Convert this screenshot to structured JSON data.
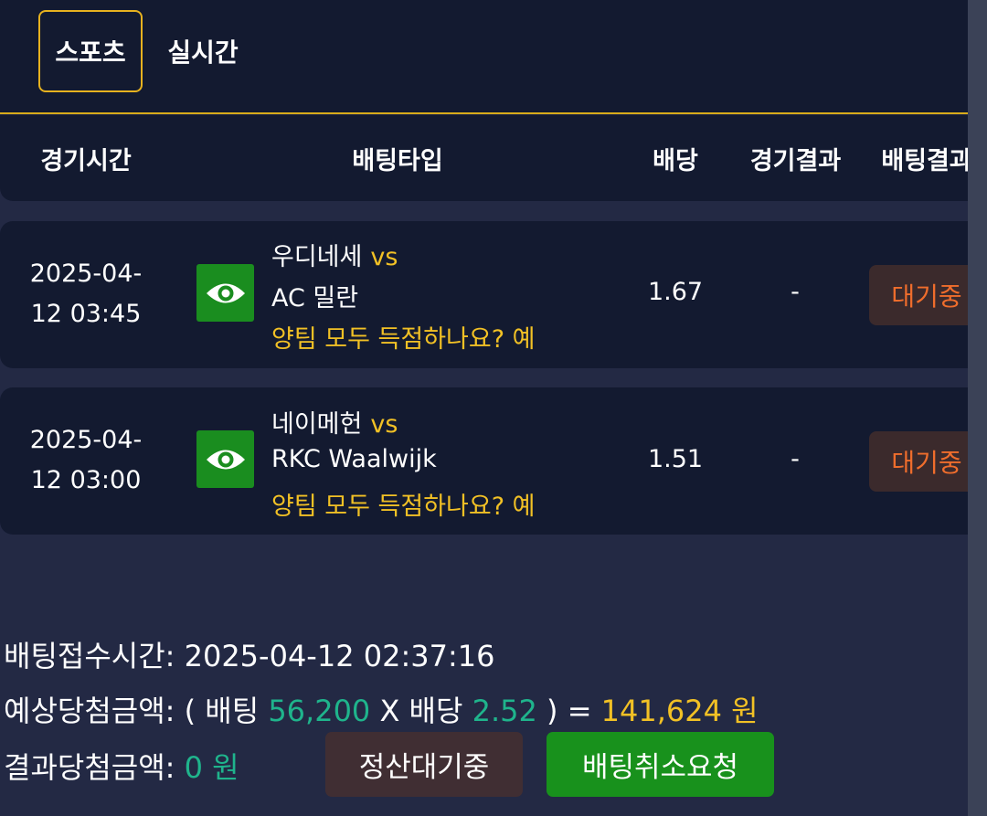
{
  "tabs": [
    {
      "label": "스포츠",
      "active": true
    },
    {
      "label": "실시간",
      "active": false
    }
  ],
  "columns": {
    "time": "경기시간",
    "bet_type": "배팅타입",
    "odds": "배당",
    "game_result": "경기결과",
    "bet_result": "배팅결과"
  },
  "bets": [
    {
      "time_line1": "2025-04-",
      "time_line2": "12 03:45",
      "home": "우디네세",
      "vs": "vs",
      "away": "AC 밀란",
      "market": "양팀 모두 득점하나요? 예",
      "odds": "1.67",
      "result": "-",
      "status": "대기중",
      "icon": "eye-icon"
    },
    {
      "time_line1": "2025-04-",
      "time_line2": "12 03:00",
      "home": "네이메헌",
      "vs": "vs",
      "away": "RKC Waalwijk",
      "market": "양팀 모두 득점하나요? 예",
      "odds": "1.51",
      "result": "-",
      "status": "대기중",
      "icon": "eye-icon"
    }
  ],
  "summary": {
    "received_label": "배팅접수시간:",
    "received_value": "2025-04-12 02:37:16",
    "expected_label": "예상당첨금액:",
    "expected_open": "( 배팅",
    "stake": "56,200",
    "times": "X 배당",
    "total_odds": "2.52",
    "expected_close": ") =",
    "expected_amount": "141,624 원",
    "actual_label": "결과당첨금액:",
    "actual_amount": "0 원"
  },
  "buttons": {
    "pending": "정산대기중",
    "cancel": "배팅취소요청"
  },
  "colors": {
    "accent_gold": "#f2c125",
    "green_value": "#1fb48c",
    "pending_orange": "#ef6d2c",
    "cancel_green": "#18911c"
  }
}
